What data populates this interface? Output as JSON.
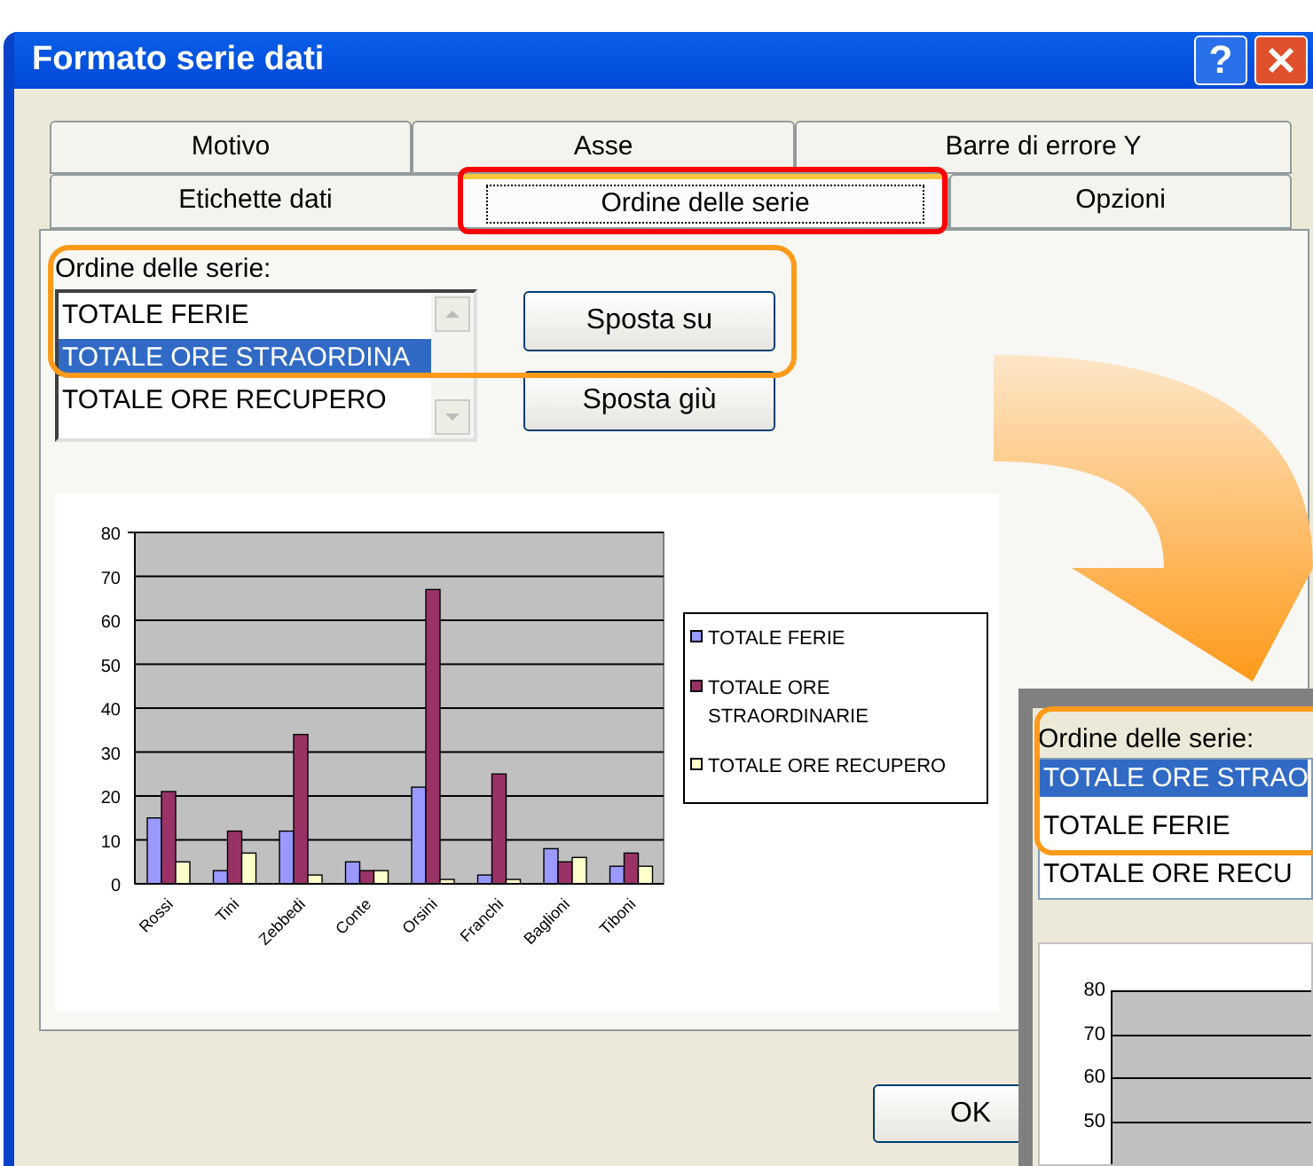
{
  "window": {
    "title": "Formato serie dati",
    "help_label": "?"
  },
  "tabs": {
    "back_row": [
      {
        "label": "Motivo",
        "selected": false
      },
      {
        "label": "Asse",
        "selected": false
      },
      {
        "label": "Barre di errore Y",
        "selected": false
      }
    ],
    "front_row": [
      {
        "label": "Etichette dati",
        "selected": false
      },
      {
        "label": "Ordine delle serie",
        "selected": true
      },
      {
        "label": "Opzioni",
        "selected": false
      }
    ]
  },
  "series_order": {
    "label": "Ordine delle serie:",
    "items": [
      {
        "label": "TOTALE FERIE",
        "selected": false
      },
      {
        "label": "TOTALE ORE STRAORDINA",
        "selected": true
      },
      {
        "label": "TOTALE ORE RECUPERO",
        "selected": false
      }
    ]
  },
  "buttons": {
    "move_up": "Sposta su",
    "move_down": "Sposta giù"
  },
  "chart": {
    "chart_data": {
      "type": "bar",
      "categories": [
        "Rossi",
        "Tini",
        "Zebbedi",
        "Conte",
        "Orsini",
        "Franchi",
        "Baglioni",
        "Tiboni"
      ],
      "series": [
        {
          "name": "TOTALE FERIE",
          "color": "#9999ff",
          "values": [
            15,
            3,
            12,
            5,
            22,
            2,
            8,
            4
          ]
        },
        {
          "name": "TOTALE ORE STRAORDINARIE",
          "color": "#993366",
          "values": [
            21,
            12,
            34,
            3,
            67,
            25,
            5,
            7
          ]
        },
        {
          "name": "TOTALE ORE RECUPERO",
          "color": "#ffffcc",
          "values": [
            5,
            7,
            2,
            3,
            1,
            1,
            6,
            4
          ]
        }
      ],
      "ylim": [
        0,
        80
      ],
      "grid": true,
      "legend": "right",
      "yticks": [
        0,
        10,
        20,
        30,
        40,
        50,
        60,
        70,
        80
      ]
    }
  },
  "ok_button": "OK",
  "inset": {
    "label": "Ordine delle serie:",
    "items": [
      {
        "label": "TOTALE ORE STRAO",
        "selected": true
      },
      {
        "label": "TOTALE FERIE",
        "selected": false
      },
      {
        "label": "TOTALE ORE RECU",
        "selected": false
      }
    ],
    "axis_ticks": [
      "80",
      "70",
      "60",
      "50"
    ]
  }
}
